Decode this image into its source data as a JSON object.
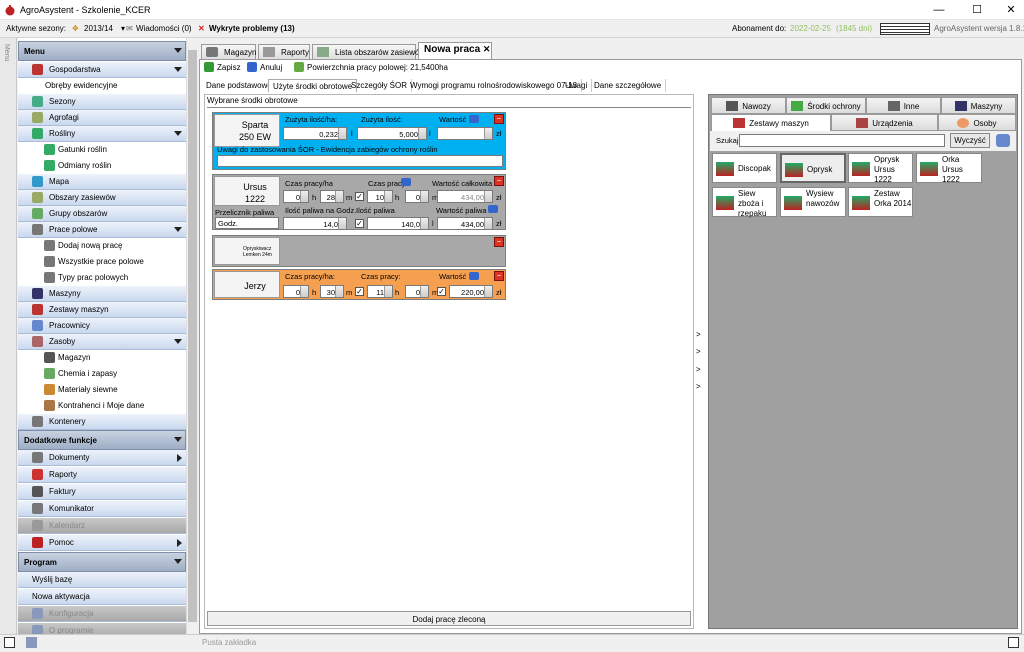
{
  "window": {
    "title": "AgroAsystent - Szkolenie_KCER",
    "min": "—",
    "max": "☐",
    "close": "✕"
  },
  "topbar": {
    "seasons_label": "Aktywne sezony:",
    "season": "2013/14",
    "messages": "Wiadomości (0)",
    "problems": "Wykryte problemy (13)",
    "subscription_label": "Abonament do:",
    "subscription_date": "2022-02-25",
    "days": "(1845 dni)",
    "version": "AgroAsystent wersja 1.8.18"
  },
  "sidestrip": {
    "label": "Menu"
  },
  "menu": {
    "header": "Menu",
    "items": [
      {
        "label": "Gospodarstwa",
        "type": "group"
      },
      {
        "label": "Obręby ewidencyjne",
        "type": "sub2"
      },
      {
        "label": "Sezony",
        "type": "item"
      },
      {
        "label": "Agrofagi",
        "type": "item"
      },
      {
        "label": "Rośliny",
        "type": "group"
      },
      {
        "label": "Gatunki roślin",
        "type": "sub"
      },
      {
        "label": "Odmiany roślin",
        "type": "sub"
      },
      {
        "label": "Mapa",
        "type": "item"
      },
      {
        "label": "Obszary zasiewów",
        "type": "item"
      },
      {
        "label": "Grupy obszarów",
        "type": "item"
      },
      {
        "label": "Prace polowe",
        "type": "group"
      },
      {
        "label": "Dodaj nową pracę",
        "type": "sub"
      },
      {
        "label": "Wszystkie prace polowe",
        "type": "sub"
      },
      {
        "label": "Typy prac polowych",
        "type": "sub"
      },
      {
        "label": "Maszyny",
        "type": "item"
      },
      {
        "label": "Zestawy maszyn",
        "type": "item"
      },
      {
        "label": "Pracownicy",
        "type": "item"
      },
      {
        "label": "Zasoby",
        "type": "group"
      },
      {
        "label": "Magazyn",
        "type": "sub"
      },
      {
        "label": "Chemia i zapasy",
        "type": "sub"
      },
      {
        "label": "Materiały siewne",
        "type": "sub"
      },
      {
        "label": "Kontrahenci i Moje dane",
        "type": "sub"
      },
      {
        "label": "Kontenery",
        "type": "item"
      }
    ],
    "extra_header": "Dodatkowe funkcje",
    "extra": [
      {
        "label": "Dokumenty"
      },
      {
        "label": "Raporty"
      },
      {
        "label": "Faktury"
      },
      {
        "label": "Komunikator"
      },
      {
        "label": "Kalendarz"
      },
      {
        "label": "Pomoc"
      }
    ],
    "program_header": "Program",
    "program": [
      {
        "label": "Wyślij bazę"
      },
      {
        "label": "Nowa aktywacja"
      },
      {
        "label": "Konfiguracja"
      },
      {
        "label": "O programie"
      }
    ]
  },
  "tabs": [
    {
      "label": "Magazyn"
    },
    {
      "label": "Raporty"
    },
    {
      "label": "Lista obszarów zasiewów"
    },
    {
      "label": "Nowa praca"
    }
  ],
  "tab_close": "✕",
  "toolbar": {
    "save": "Zapisz",
    "cancel": "Anuluj",
    "area": "Powierzchnia pracy polowej: 21,5400ha"
  },
  "subtabs": [
    "Dane podstawowe",
    "Użyte środki obrotowe",
    "Szczegóły ŚOR",
    "Wymogi programu rolnośrodowiskowego 07-13",
    "Uwagi",
    "Dane szczegółowe"
  ],
  "left": {
    "header": "Wybrane środki obrotowe",
    "chem": {
      "name": "Sparta 250 EW",
      "l_dose": "Zużyta ilość/ha:",
      "l_used": "Zużyta ilość:",
      "l_value": "Wartość",
      "dose": "0,232",
      "used": "5,000",
      "unit": "l",
      "notes_label": "Uwagi do zastosowania ŚOR - Ewidencja zabiegów ochrony roślin"
    },
    "machine": {
      "name": "Ursus 1222",
      "l_time_ha": "Czas pracy/ha",
      "l_time": "Czas pracy",
      "l_total": "Wartość całkowita",
      "h": "0",
      "m": "28",
      "th": "10",
      "tm": "0",
      "total": "434,00",
      "cur": "zł",
      "l_conv": "Przelicznik paliwa",
      "conv": "Godz.",
      "l_fuel_h": "Ilość paliwa na Godz.",
      "fuel_h": "14,0",
      "l_fuel": "Ilość paliwa",
      "fuel": "140,0",
      "l_fuel_val": "Wartość paliwa",
      "fuel_val": "434,00",
      "unit_h": "h",
      "unit_m": "m",
      "unit_l": "l"
    },
    "tool": {
      "name": "Opryskiwacz Lemken 24m"
    },
    "worker": {
      "name": "Jerzy",
      "l_time_ha": "Czas pracy/ha:",
      "l_time": "Czas pracy:",
      "l_value": "Wartość",
      "h": "0",
      "m": "30",
      "th": "11",
      "tm": "0",
      "value": "220,00",
      "cur": "zł"
    },
    "add_button": "Dodaj pracę zleconą"
  },
  "right": {
    "tabs_row1": [
      "Nawozy",
      "Środki ochrony",
      "Inne",
      "Maszyny"
    ],
    "tabs_row2": [
      "Zestawy maszyn",
      "Urządzenia",
      "Osoby"
    ],
    "search_label": "Szukaj",
    "clear": "Wyczyść",
    "tiles": [
      "Discopak",
      "Oprysk",
      "Oprysk Ursus 1222",
      "Orka Ursus 1222",
      "Siew zboża i rzepaku",
      "Wysiew nawozów",
      "Zestaw Orka 2014"
    ]
  },
  "status": {
    "text": "Pusta zakładka"
  },
  "colors": {
    "blue": "#00b0f0",
    "orange": "#f4a050",
    "grey_card": "#a8a8a8",
    "green_date": "#90c060"
  }
}
